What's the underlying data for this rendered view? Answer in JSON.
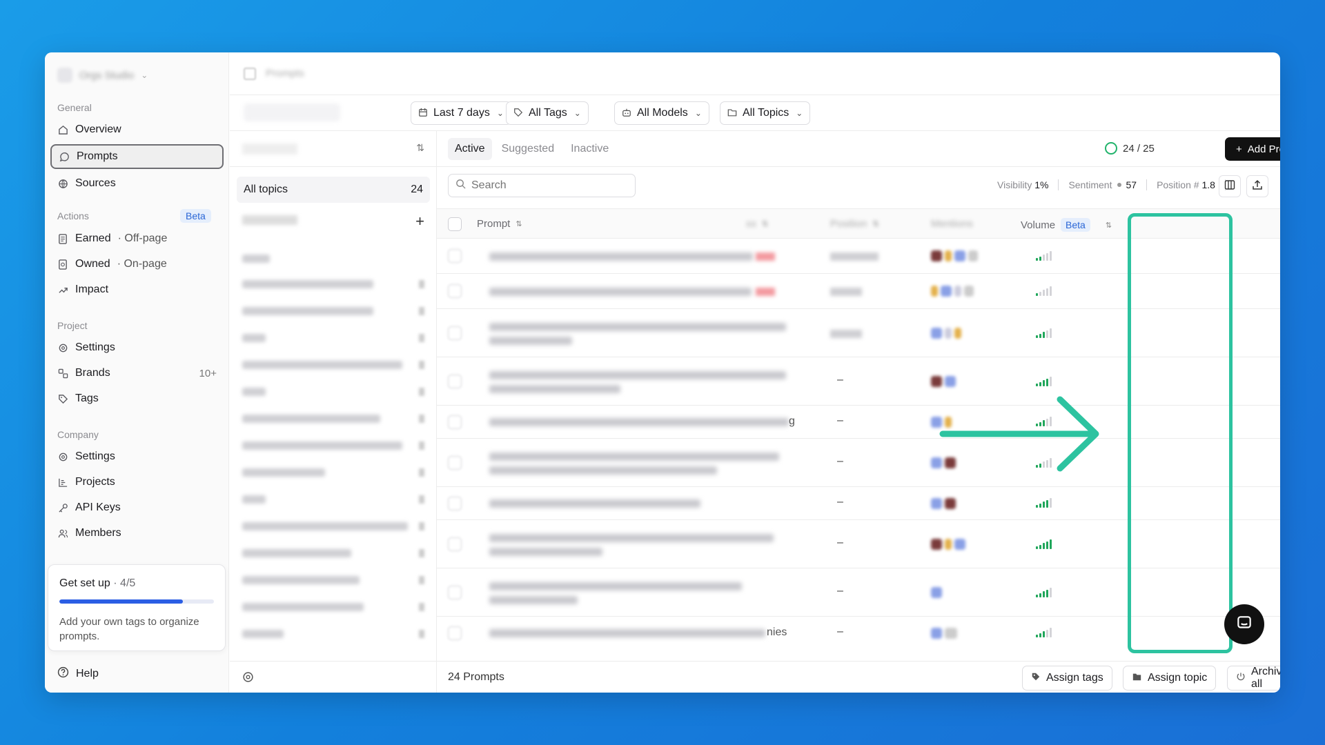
{
  "sidebar": {
    "sections": {
      "general": "General",
      "actions": "Actions",
      "project": "Project",
      "company": "Company"
    },
    "general_items": [
      {
        "label": "Overview"
      },
      {
        "label": "Prompts"
      },
      {
        "label": "Sources"
      }
    ],
    "actions_beta": "Beta",
    "actions_items": [
      {
        "label": "Earned",
        "sub": "· Off-page"
      },
      {
        "label": "Owned",
        "sub": "· On-page"
      },
      {
        "label": "Impact"
      }
    ],
    "project_items": [
      {
        "label": "Settings"
      },
      {
        "label": "Brands",
        "badge": "10+"
      },
      {
        "label": "Tags"
      }
    ],
    "company_items": [
      {
        "label": "Settings"
      },
      {
        "label": "Projects"
      },
      {
        "label": "API Keys"
      },
      {
        "label": "Members"
      }
    ],
    "setup": {
      "title": "Get set up",
      "count": "· 4/5",
      "progress": 0.8,
      "text": "Add your own tags to organize prompts."
    },
    "help": "Help"
  },
  "filters": {
    "date": "Last 7 days",
    "tags": "All Tags",
    "models": "All Models",
    "topics": "All Topics"
  },
  "topics": {
    "all_label": "All topics",
    "all_count": "24"
  },
  "prompts": {
    "tabs": [
      "Active",
      "Suggested",
      "Inactive"
    ],
    "active_tab": "Active",
    "usage": "24 / 25",
    "add_button": "Add Prompt",
    "search_placeholder": "Search",
    "metrics": {
      "visibility_label": "Visibility",
      "visibility_value": "1%",
      "sentiment_label": "Sentiment",
      "sentiment_value": "57",
      "position_label": "Position #",
      "position_value": "1.8"
    },
    "columns": {
      "prompt": "Prompt",
      "volume": "Volume",
      "volume_badge": "Beta"
    },
    "visible_fragments": {
      "row5_tail": "g",
      "row10_tail": "nies"
    },
    "volume_levels": [
      2,
      1,
      3,
      4,
      3,
      2,
      4,
      5,
      4,
      3
    ],
    "footer": {
      "count": "24 Prompts",
      "assign_tags": "Assign tags",
      "assign_topic": "Assign topic",
      "archive_all": "Archive all"
    }
  },
  "colors": {
    "accent": "#2b5ee4",
    "highlight": "#2dc3a0",
    "volume_on": "#1fa65a",
    "volume_off": "#d4d4d8"
  }
}
